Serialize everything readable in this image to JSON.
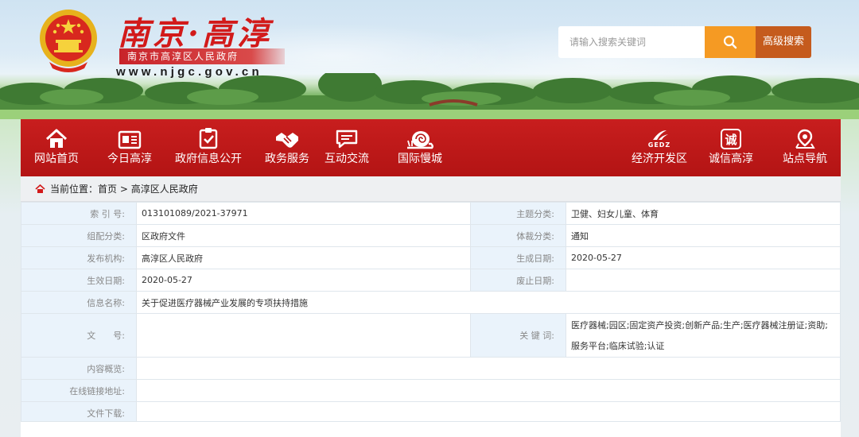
{
  "header": {
    "title": "南京·高淳",
    "subtitle": "南京市高淳区人民政府",
    "url": "www.njgc.gov.cn",
    "search_placeholder": "请输入搜索关键词",
    "advanced_search_label": "高级搜索"
  },
  "nav": {
    "items": [
      {
        "label": "网站首页",
        "icon": "home-icon"
      },
      {
        "label": "今日高淳",
        "icon": "newspaper-icon"
      },
      {
        "label": "政府信息公开",
        "icon": "clipboard-check-icon"
      },
      {
        "label": "政务服务",
        "icon": "handshake-icon"
      },
      {
        "label": "互动交流",
        "icon": "chat-icon"
      },
      {
        "label": "国际慢城",
        "icon": "snail-icon"
      },
      {
        "label": "经济开发区",
        "icon": "gedz-logo-icon",
        "logo_text": "GEDZ"
      },
      {
        "label": "诚信高淳",
        "icon": "integrity-badge-icon",
        "badge_text": "诚"
      },
      {
        "label": "站点导航",
        "icon": "location-pin-icon"
      }
    ]
  },
  "breadcrumb": {
    "prefix": "当前位置：",
    "path": "首页 > 高淳区人民政府"
  },
  "info": {
    "index_no_label": "索 引 号:",
    "index_no": "013101089/2021-37971",
    "topic_label": "主题分类:",
    "topic": "卫健、妇女儿童、体育",
    "org_class_label": "组配分类:",
    "org_class": "区政府文件",
    "genre_label": "体裁分类:",
    "genre": "通知",
    "publisher_label": "发布机构:",
    "publisher": "高淳区人民政府",
    "created_label": "生成日期:",
    "created": "2020-05-27",
    "effective_label": "生效日期:",
    "effective": "2020-05-27",
    "abolished_label": "废止日期:",
    "abolished": "",
    "name_label": "信息名称:",
    "name": "关于促进医疗器械产业发展的专项扶持措施",
    "doc_no_label": "文　　号:",
    "doc_no": "",
    "keywords_label": "关 键 词:",
    "keywords": "医疗器械;园区;固定资产投资;创新产品;生产;医疗器械注册证;资助;服务平台;临床试验;认证",
    "summary_label": "内容概览:",
    "summary": "",
    "online_link_label": "在线链接地址:",
    "online_link": "",
    "download_label": "文件下载:",
    "download": ""
  },
  "colors": {
    "nav_red": "#c81e1e",
    "title_red": "#d21a1a",
    "search_orange": "#f59a23",
    "advanced_brown": "#c55b1d",
    "label_bg": "#eaf3fb"
  }
}
